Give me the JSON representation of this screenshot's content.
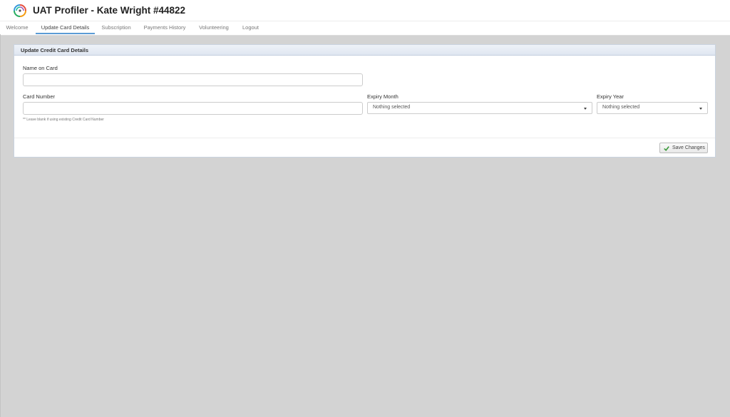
{
  "header": {
    "title": "UAT Profiler - Kate Wright #44822",
    "logo_icon": "swirl-logo-icon"
  },
  "nav": {
    "tabs": [
      {
        "label": "Welcome",
        "active": false
      },
      {
        "label": "Update Card Details",
        "active": true
      },
      {
        "label": "Subscription",
        "active": false
      },
      {
        "label": "Payments History",
        "active": false
      },
      {
        "label": "Volunteering",
        "active": false
      },
      {
        "label": "Logout",
        "active": false
      }
    ],
    "active_color": "#5b9bd5"
  },
  "panel": {
    "title": "Update Credit Card Details",
    "name_on_card": {
      "label": "Name on Card",
      "value": "",
      "placeholder": ""
    },
    "card_number": {
      "label": "Card Number",
      "value": "",
      "placeholder": ""
    },
    "card_help": "** Leave blank if using existing Credit Card Number",
    "expiry_month": {
      "label": "Expiry Month",
      "selected": "Nothing selected"
    },
    "expiry_year": {
      "label": "Expiry Year",
      "selected": "Nothing selected"
    },
    "save_label": "Save Changes",
    "save_icon_color": "#3c9b3c"
  }
}
